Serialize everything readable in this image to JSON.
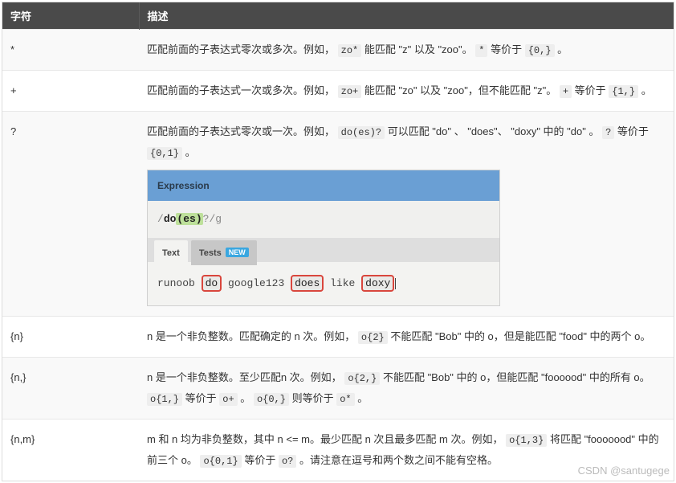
{
  "header": {
    "col1": "字符",
    "col2": "描述"
  },
  "rows": {
    "star": {
      "sym": "*",
      "pre": "匹配前面的子表达式零次或多次。例如，",
      "code1": "zo*",
      "mid1": " 能匹配 \"z\" 以及 \"zoo\"。",
      "code2": "*",
      "mid2": " 等价于 ",
      "code3": "{0,}",
      "tail": "。"
    },
    "plus": {
      "sym": "+",
      "pre": "匹配前面的子表达式一次或多次。例如，",
      "code1": "zo+",
      "mid1": " 能匹配 \"zo\" 以及 \"zoo\"，但不能匹配 \"z\"。",
      "code2": "+",
      "mid2": " 等价于 ",
      "code3": "{1,}",
      "tail": "。"
    },
    "qmark": {
      "sym": "?",
      "pre": "匹配前面的子表达式零次或一次。例如，",
      "code1": "do(es)?",
      "mid1": " 可以匹配 \"do\" 、 \"does\"、 \"doxy\" 中的 \"do\" 。",
      "code2": "?",
      "mid2": " 等价于 ",
      "code3": "{0,1}",
      "tail": "。"
    },
    "n": {
      "sym": "{n}",
      "pre": "n 是一个非负整数。匹配确定的 n 次。例如，",
      "code1": "o{2}",
      "mid1": " 不能匹配 \"Bob\" 中的 o，但是能匹配 \"food\" 中的两个 o。"
    },
    "nplus": {
      "sym": "{n,}",
      "pre": "n 是一个非负整数。至少匹配n 次。例如，",
      "code1": "o{2,}",
      "mid1": " 不能匹配 \"Bob\" 中的 o，但能匹配 \"foooood\" 中的所有 o。",
      "code2": "o{1,}",
      "mid2": " 等价于 ",
      "code3": "o+",
      "mid3": "。",
      "code4": "o{0,}",
      "mid4": " 则等价于 ",
      "code5": "o*",
      "tail": "。"
    },
    "nm": {
      "sym": "{n,m}",
      "pre": "m 和 n 均为非负整数，其中 n <= m。最少匹配 n 次且最多匹配 m 次。例如，",
      "code1": "o{1,3}",
      "mid1": " 将匹配 \"fooooood\" 中的前三个 o。",
      "code2": "o{0,1}",
      "mid2": " 等价于 ",
      "code3": "o?",
      "tail": "。请注意在逗号和两个数之间不能有空格。"
    }
  },
  "tester": {
    "exp_header": "Expression",
    "expr": {
      "open": "/",
      "literal": "do",
      "group": "(es)",
      "quant": "?",
      "close": "/",
      "flags": "g"
    },
    "tabs": {
      "text": "Text",
      "tests": "Tests",
      "new": "NEW"
    },
    "sample": {
      "t1": "runoob",
      "m1": "do",
      "t2": "google123",
      "m2": "does",
      "t3": "like",
      "m3": "doxy"
    }
  },
  "watermark": "CSDN @santugege"
}
